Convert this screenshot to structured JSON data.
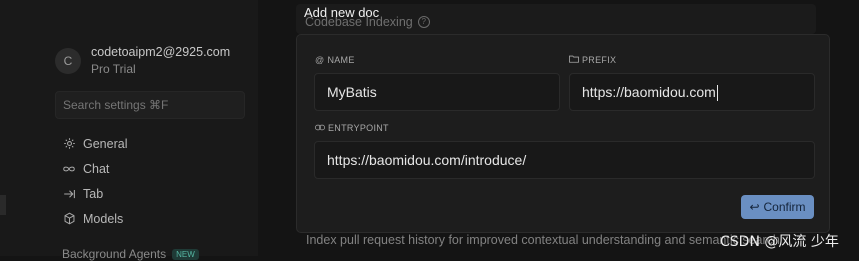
{
  "account": {
    "avatar_initial": "C",
    "email": "codetoaipm2@2925.com",
    "plan": "Pro Trial"
  },
  "search": {
    "placeholder": "Search settings ⌘F"
  },
  "nav": {
    "items": [
      {
        "label": "General",
        "icon": "gear-icon"
      },
      {
        "label": "Chat",
        "icon": "infinity-icon"
      },
      {
        "label": "Tab",
        "icon": "tab-arrow-icon"
      },
      {
        "label": "Models",
        "icon": "cube-icon"
      }
    ],
    "background_agents": {
      "label": "Background Agents",
      "badge": "NEW"
    }
  },
  "main": {
    "section_title": "Codebase Indexing",
    "bottom_text": "Index pull request history for improved contextual understanding and semantic search"
  },
  "dialog": {
    "title": "Add new doc",
    "name_label": "NAME",
    "name_value": "MyBatis",
    "prefix_label": "PREFIX",
    "prefix_value": "https://baomidou.com",
    "entrypoint_label": "ENTRYPOINT",
    "entrypoint_value": "https://baomidou.com/introduce/",
    "confirm_label": "Confirm"
  },
  "colors": {
    "background": "#141414",
    "dialog_bg": "#1d1d1d",
    "confirm_bg": "#6a8fc2",
    "badge_fg": "#56b8a4"
  },
  "watermark": "CSDN @风流 少年"
}
